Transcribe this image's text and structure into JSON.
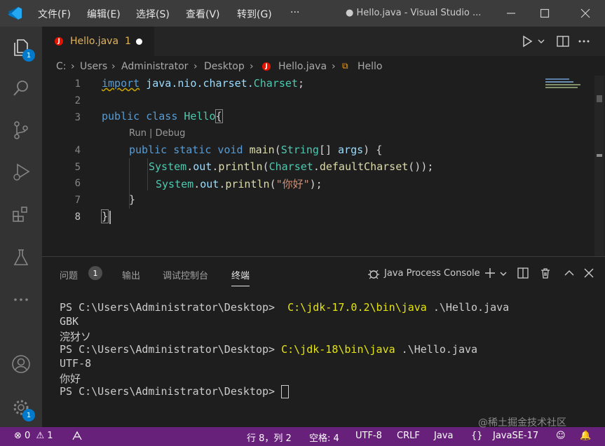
{
  "titlebar": {
    "menu": [
      "文件(F)",
      "编辑(E)",
      "选择(S)",
      "查看(V)",
      "转到(G)",
      "···"
    ],
    "title": "● Hello.java - Visual Studio ..."
  },
  "activity": {
    "explorer_badge": "1",
    "settings_badge": "1"
  },
  "tab": {
    "label": "Hello.java",
    "problems": "1"
  },
  "breadcrumb": {
    "items": [
      "C:",
      "Users",
      "Administrator",
      "Desktop",
      "Hello.java",
      "Hello"
    ]
  },
  "editor": {
    "line_numbers": [
      "1",
      "2",
      "3",
      "4",
      "5",
      "6",
      "7",
      "8"
    ],
    "codelens": "Run | Debug",
    "lines": {
      "l1_kw": "import",
      "l1_rest_a": " java.nio.charset.",
      "l1_type": "Charset",
      "l1_semi": ";",
      "l3_kw": "public class",
      "l3_name": " Hello",
      "l3_brace": "{",
      "l4_kw": "public static void",
      "l4_fn": " main",
      "l4_p1": "(",
      "l4_type": "String",
      "l4_p2": "[] ",
      "l4_arg": "args",
      "l4_p3": ") {",
      "l5_obj": "System",
      "l5_dot": ".",
      "l5_out": "out",
      "l5_dot2": ".",
      "l5_fn": "println",
      "l5_p1": "(",
      "l5_cls": "Charset",
      "l5_dot3": ".",
      "l5_fn2": "defaultCharset",
      "l5_p2": "());",
      "l6_obj": "System",
      "l6_dot": ".",
      "l6_out": "out",
      "l6_dot2": ".",
      "l6_fn": "println",
      "l6_p1": "(",
      "l6_str": "\"你好\"",
      "l6_p2": ");",
      "l7": "}",
      "l8": "}"
    }
  },
  "panel": {
    "tabs": [
      "问题",
      "输出",
      "调试控制台",
      "终端"
    ],
    "problems_count": "1",
    "console_label": "Java Process Console",
    "terminal": [
      {
        "prompt": "PS C:\\Users\\Administrator\\Desktop> ",
        "cmd": " C:\\jdk-17.0.2\\bin\\java",
        "rest": " .\\Hello.java"
      },
      {
        "prompt": "GBK",
        "cmd": "",
        "rest": ""
      },
      {
        "prompt": "浣犲ソ",
        "cmd": "",
        "rest": ""
      },
      {
        "prompt": "PS C:\\Users\\Administrator\\Desktop> ",
        "cmd": "C:\\jdk-18\\bin\\java",
        "rest": " .\\Hello.java"
      },
      {
        "prompt": "UTF-8",
        "cmd": "",
        "rest": ""
      },
      {
        "prompt": "你好",
        "cmd": "",
        "rest": ""
      },
      {
        "prompt": "PS C:\\Users\\Administrator\\Desktop> ",
        "cmd": "",
        "rest": ""
      }
    ]
  },
  "statusbar": {
    "errors": "0",
    "warnings": "1",
    "position": "行 8，列 2",
    "spaces": "空格: 4",
    "encoding": "UTF-8",
    "eol": "CRLF",
    "language": "Java",
    "runtime": "JavaSE-17",
    "watermark": "@稀土掘金技术社区"
  },
  "colors": {
    "statusbar": "#68217a",
    "accent": "#007acc",
    "titlebar": "#3c3c3c"
  }
}
